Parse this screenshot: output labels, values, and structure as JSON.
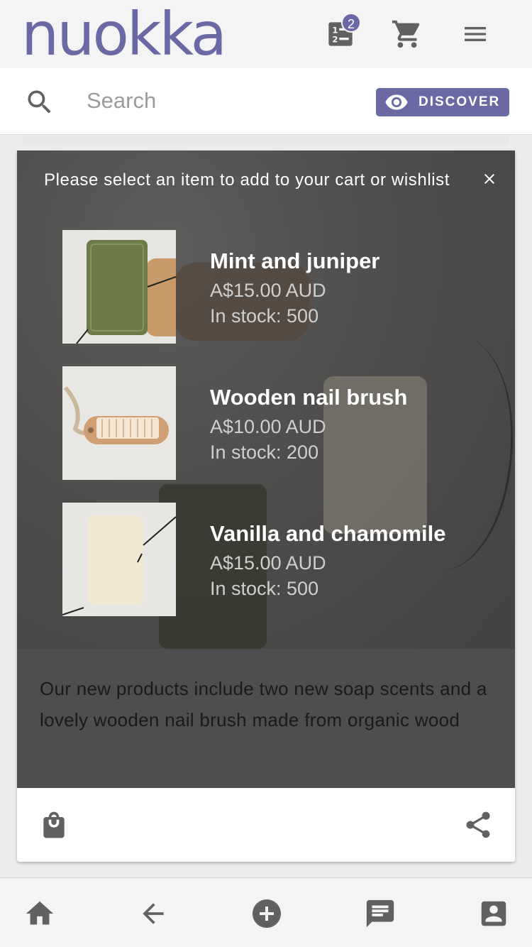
{
  "app": {
    "logo_text": "nuokka",
    "brand_color": "#6b69a3",
    "icons": [
      "list-icon",
      "cart-icon",
      "menu-icon"
    ],
    "list_badge": "2"
  },
  "search": {
    "placeholder": "Search",
    "value": "",
    "discover_label": "DISCOVER"
  },
  "popup": {
    "title": "Please select an item to add to your cart or wishlist",
    "products": [
      {
        "name": "Mint and juniper",
        "price": "A$15.00 AUD",
        "stock": "In stock: 500",
        "image": "green soap bar"
      },
      {
        "name": "Wooden nail brush",
        "price": "A$10.00 AUD",
        "stock": "In stock: 200",
        "image": "wooden nail brush with rope"
      },
      {
        "name": "Vanilla and chamomile",
        "price": "A$15.00 AUD",
        "stock": "In stock: 500",
        "image": "cream soap bar"
      }
    ]
  },
  "post": {
    "description": "Our new products include two new soap scents and a lovely wooden nail brush made from organic wood"
  },
  "bottom_nav": [
    "home-icon",
    "back-arrow-icon",
    "add-circle-icon",
    "chat-icon",
    "account-icon"
  ]
}
